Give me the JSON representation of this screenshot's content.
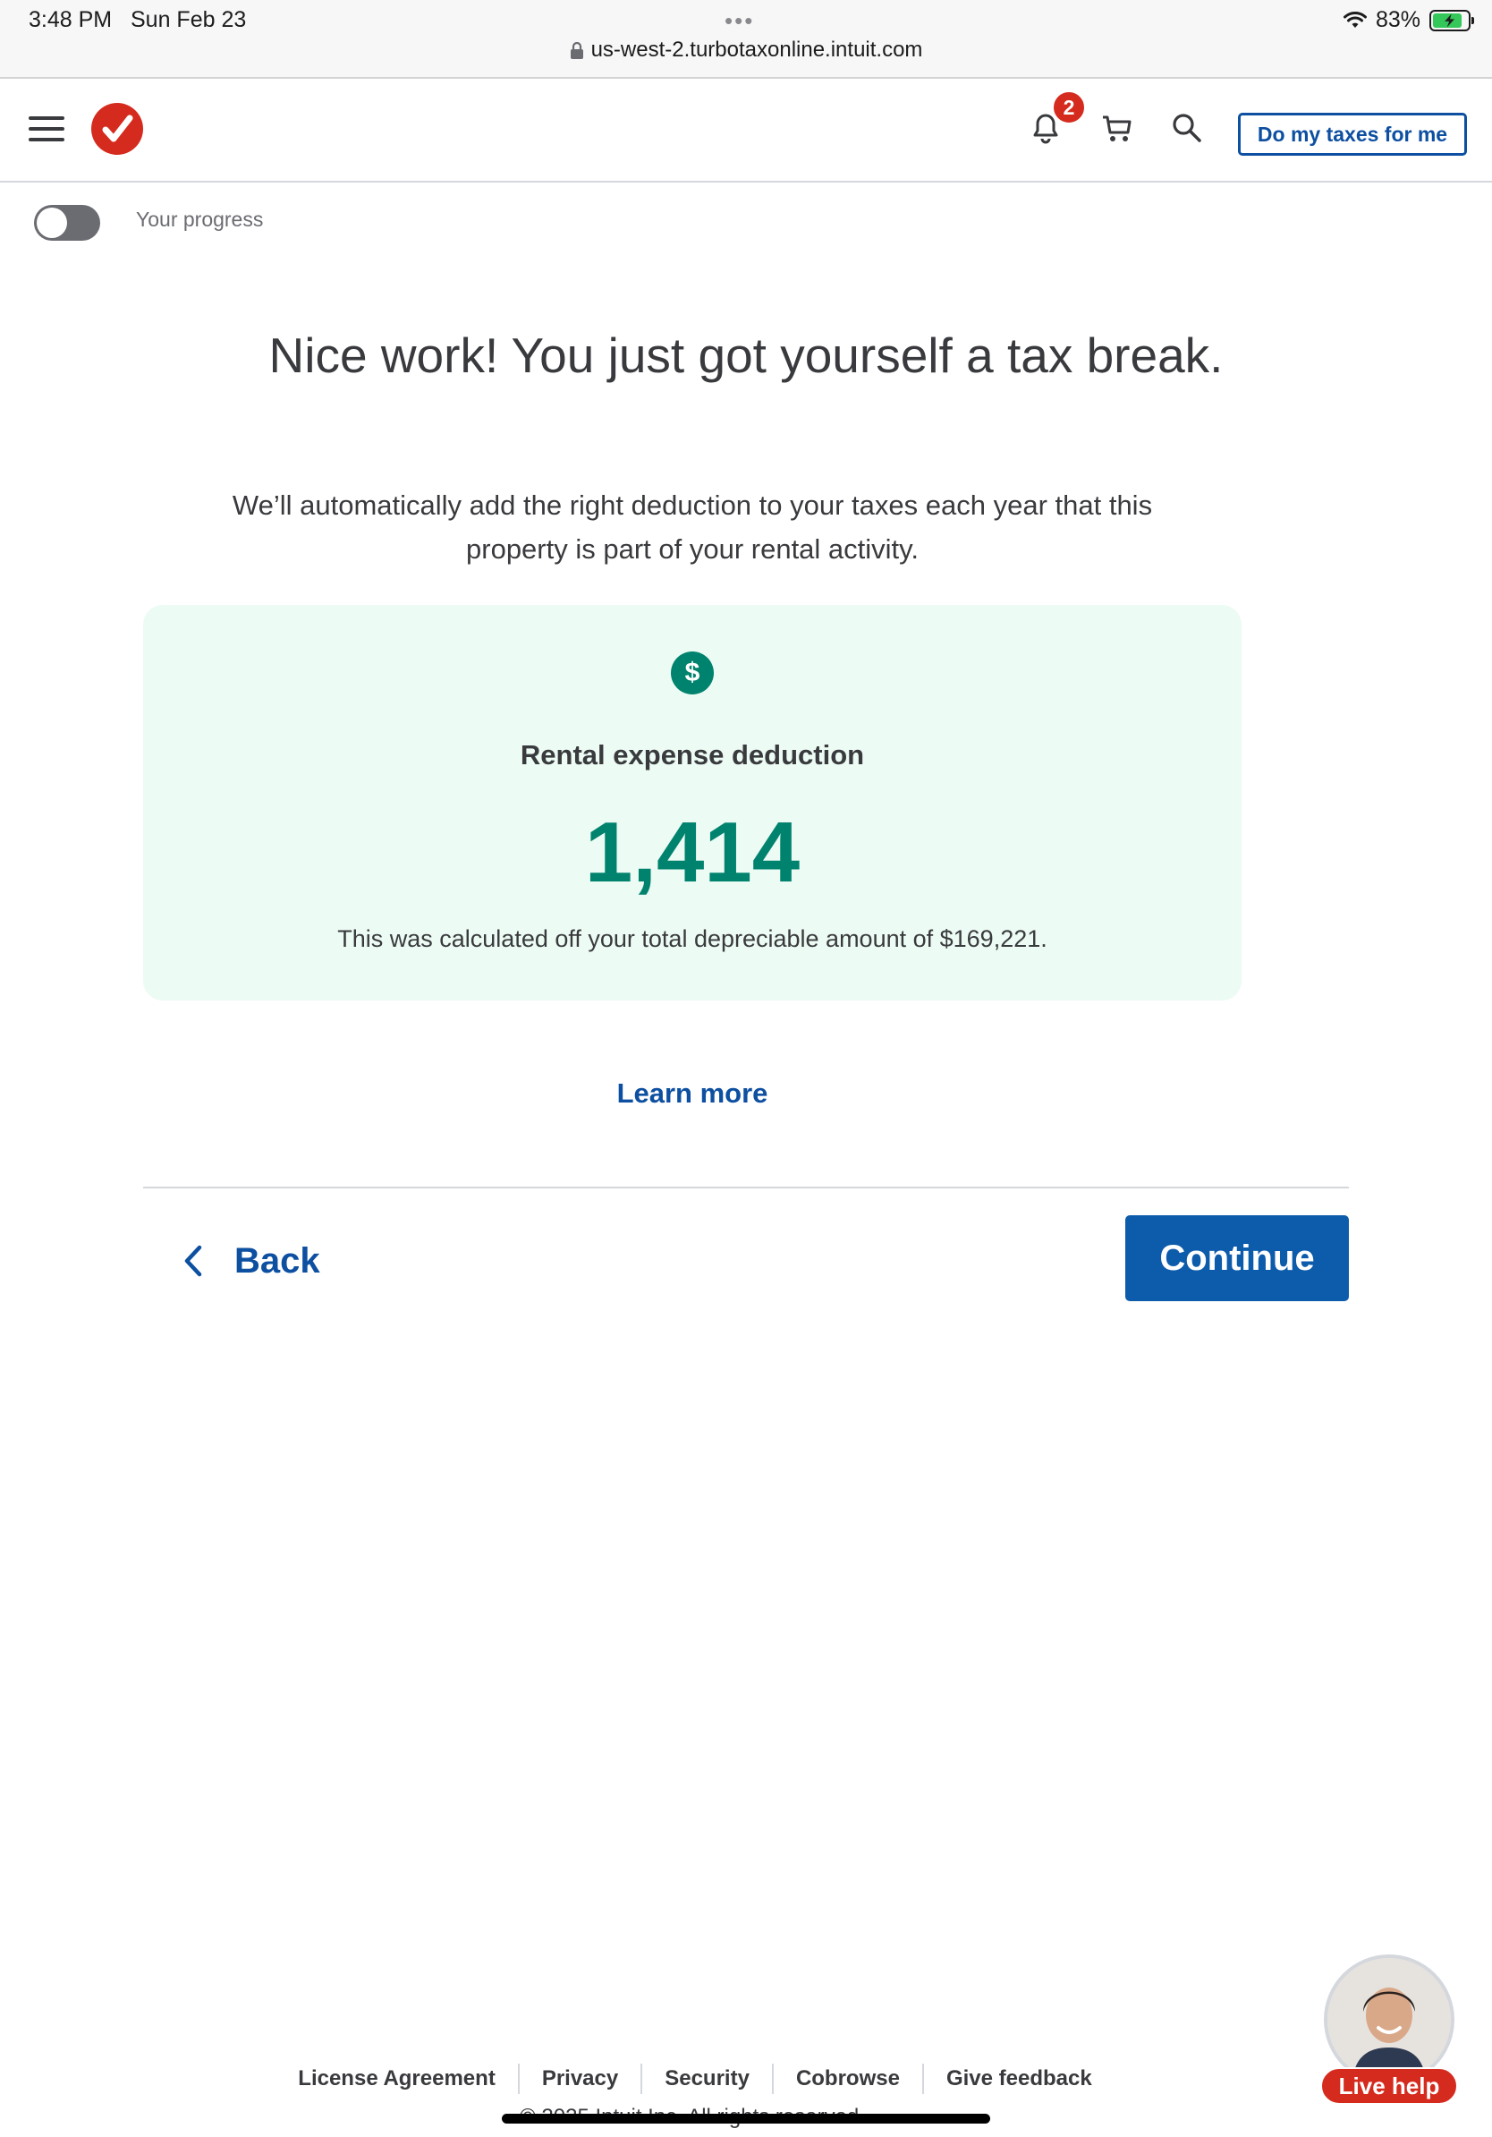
{
  "status_bar": {
    "time": "3:48 PM",
    "date": "Sun Feb 23",
    "url": "us-west-2.turbotaxonline.intuit.com",
    "battery": "83%",
    "battery_level": 0.83
  },
  "header": {
    "notification_count": "2",
    "cta_label": "Do my taxes for me",
    "brand_color": "#d52b1e",
    "accent_color": "#0d4fa0"
  },
  "progress": {
    "label": "Your progress",
    "toggle_on": false
  },
  "main": {
    "headline": "Nice work! You just got yourself a tax break.",
    "subtext": "We’ll automatically add the right deduction to your taxes each year that this property is part of your rental activity.",
    "card": {
      "icon": "dollar-icon",
      "title": "Rental expense deduction",
      "amount": "1,414",
      "note": "This was calculated off your total depreciable amount of $169,221.",
      "background_color": "#ecfbf3",
      "amount_color": "#00836e"
    },
    "learn_more": "Learn more"
  },
  "nav": {
    "back_label": "Back",
    "continue_label": "Continue"
  },
  "footer": {
    "links": [
      "License Agreement",
      "Privacy",
      "Security",
      "Cobrowse",
      "Give feedback"
    ],
    "copyright": "© 2025 Intuit Inc. All rights reserved."
  },
  "live_help": {
    "label": "Live help"
  }
}
